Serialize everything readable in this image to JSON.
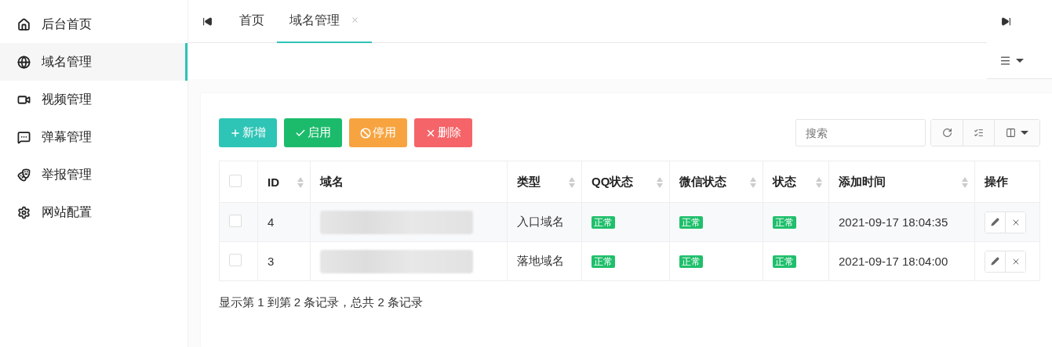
{
  "sidebar": {
    "items": [
      {
        "label": "后台首页",
        "selected": false
      },
      {
        "label": "域名管理",
        "selected": true
      },
      {
        "label": "视频管理",
        "selected": false
      },
      {
        "label": "弹幕管理",
        "selected": false
      },
      {
        "label": "举报管理",
        "selected": false
      },
      {
        "label": "网站配置",
        "selected": false
      }
    ]
  },
  "tabs": [
    {
      "label": "首页",
      "selected": false,
      "closable": false
    },
    {
      "label": "域名管理",
      "selected": true,
      "closable": true
    }
  ],
  "toolbar": {
    "buttons": [
      {
        "label": "新增",
        "kind": "add"
      },
      {
        "label": "启用",
        "kind": "enable"
      },
      {
        "label": "停用",
        "kind": "disable"
      },
      {
        "label": "删除",
        "kind": "delete"
      }
    ],
    "search": {
      "placeholder": "搜索"
    }
  },
  "table": {
    "all_checked": false,
    "columns": [
      {
        "label": "ID",
        "sortable": true
      },
      {
        "label": "域名",
        "sortable": false
      },
      {
        "label": "类型",
        "sortable": true
      },
      {
        "label": "QQ状态",
        "sortable": true
      },
      {
        "label": "微信状态",
        "sortable": true
      },
      {
        "label": "状态",
        "sortable": true
      },
      {
        "label": "添加时间",
        "sortable": true
      },
      {
        "label": "操作",
        "sortable": false
      }
    ],
    "rows": [
      {
        "checked": false,
        "id": "4",
        "type": "入口域名",
        "qq": "正常",
        "wechat": "正常",
        "status": "正常",
        "time": "2021-09-17 18:04:35"
      },
      {
        "checked": false,
        "id": "3",
        "type": "落地域名",
        "qq": "正常",
        "wechat": "正常",
        "status": "正常",
        "time": "2021-09-17 18:04:00"
      }
    ]
  },
  "summary": "显示第 1 到第 2 条记录，总共 2 条记录"
}
